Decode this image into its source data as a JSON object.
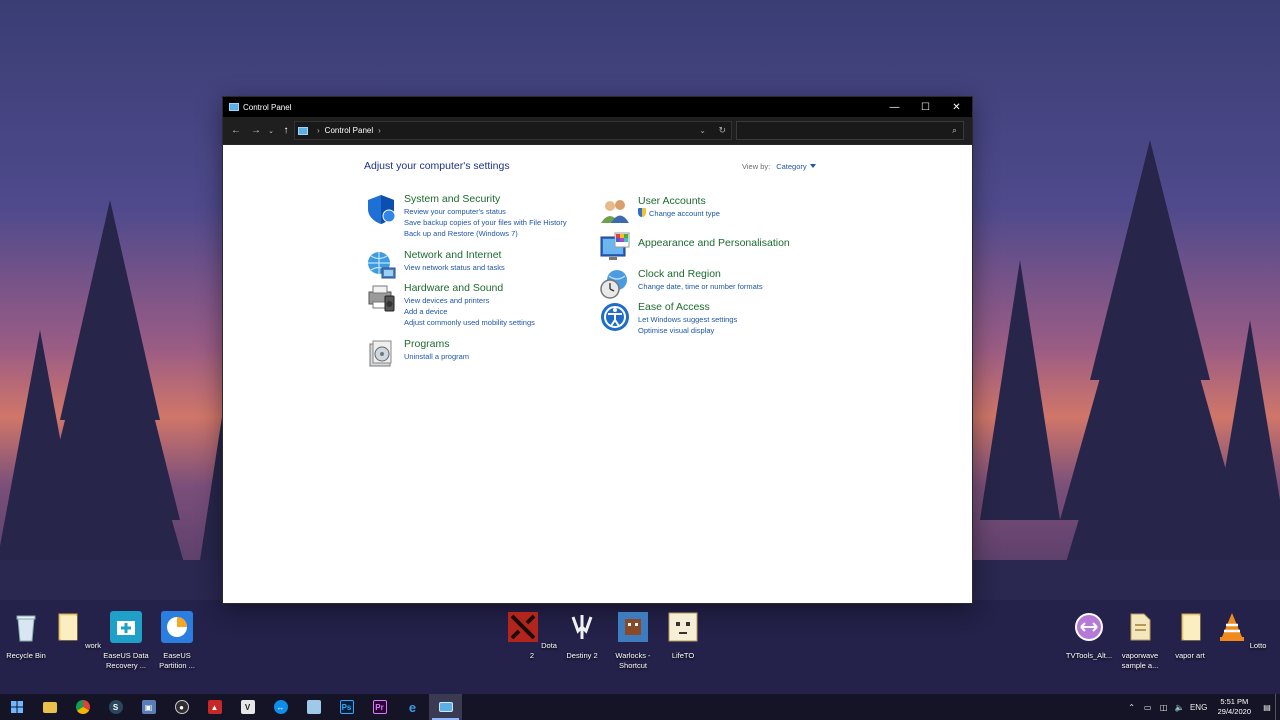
{
  "window": {
    "title": "Control Panel",
    "breadcrumb": [
      "Control Panel"
    ],
    "search_placeholder": "",
    "buttons": {
      "minimize": "—",
      "maximize": "☐",
      "close": "✕"
    }
  },
  "content": {
    "heading": "Adjust your computer's settings",
    "view_by_label": "View by:",
    "view_by_value": "Category",
    "categories_left": [
      {
        "title": "System and Security",
        "icon": "shield-icon",
        "links": [
          "Review your computer's status",
          "Save backup copies of your files with File History",
          "Back up and Restore (Windows 7)"
        ]
      },
      {
        "title": "Network and Internet",
        "icon": "network-globe-icon",
        "links": [
          "View network status and tasks"
        ]
      },
      {
        "title": "Hardware and Sound",
        "icon": "printer-speaker-icon",
        "links": [
          "View devices and printers",
          "Add a device",
          "Adjust commonly used mobility settings"
        ]
      },
      {
        "title": "Programs",
        "icon": "programs-disc-icon",
        "links": [
          "Uninstall a program"
        ]
      }
    ],
    "categories_right": [
      {
        "title": "User Accounts",
        "icon": "users-icon",
        "links": [
          "Change account type"
        ]
      },
      {
        "title": "Appearance and Personalisation",
        "icon": "monitor-palette-icon",
        "links": []
      },
      {
        "title": "Clock and Region",
        "icon": "clock-globe-icon",
        "links": [
          "Change date, time or number formats"
        ]
      },
      {
        "title": "Ease of Access",
        "icon": "ease-of-access-icon",
        "links": [
          "Let Windows suggest settings",
          "Optimise visual display"
        ]
      }
    ]
  },
  "desktop_icons": [
    {
      "label": "Recycle Bin",
      "icon": "recycle-bin-icon"
    },
    {
      "label": "work",
      "icon": "folder-icon"
    },
    {
      "label": "EaseUS Data Recovery ...",
      "icon": "easeus-recovery-icon"
    },
    {
      "label": "EaseUS Partition ...",
      "icon": "easeus-partition-icon"
    },
    {
      "label": "Dota 2",
      "icon": "dota2-icon"
    },
    {
      "label": "Destiny 2",
      "icon": "destiny2-icon"
    },
    {
      "label": "Warlocks - Shortcut",
      "icon": "warlocks-icon"
    },
    {
      "label": "LifeTO",
      "icon": "lifeto-icon"
    },
    {
      "label": "TVTools_Alt...",
      "icon": "tvtools-icon"
    },
    {
      "label": "vaporwave sample a...",
      "icon": "file-icon"
    },
    {
      "label": "vapor art",
      "icon": "folder-icon"
    },
    {
      "label": "Lotto",
      "icon": "vlc-icon"
    }
  ],
  "taskbar": {
    "apps": [
      "start-icon",
      "file-explorer-icon",
      "chrome-icon",
      "steam-icon",
      "virtualbox-icon",
      "obs-icon",
      "red-app-icon",
      "vm-app-icon",
      "teamviewer-icon",
      "notes-app-icon",
      "photoshop-icon",
      "premiere-icon",
      "edge-icon",
      "control-panel-icon"
    ],
    "tray": {
      "language": "ENG",
      "time": "5:51 PM",
      "date": "29/4/2020"
    }
  },
  "colors": {
    "link": "#1e56a8",
    "category_title": "#1d6a2f",
    "heading": "#1e3287",
    "titlebar": "#000000"
  }
}
